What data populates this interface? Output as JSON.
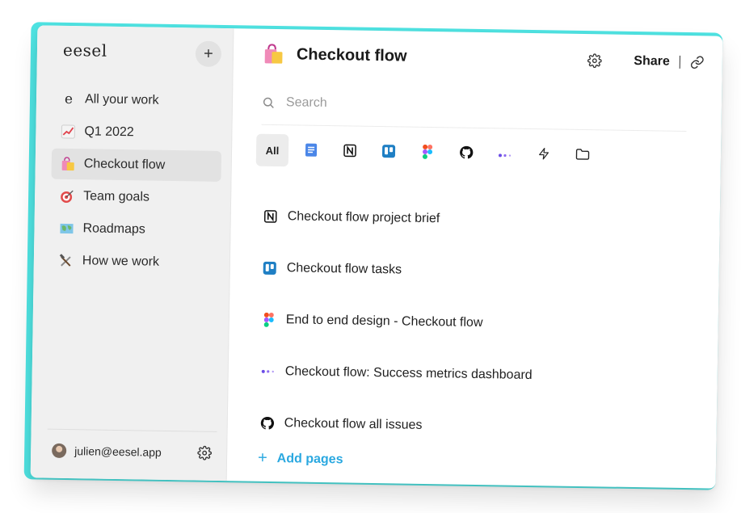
{
  "app": {
    "logo": "eesel"
  },
  "sidebar": {
    "add_symbol": "+",
    "items": [
      {
        "label": "All your work",
        "icon": "eesel-e-icon",
        "glyph": "e"
      },
      {
        "label": "Q1 2022",
        "icon": "chart-increasing-emoji",
        "glyph": "📈"
      },
      {
        "label": "Checkout flow",
        "icon": "shopping-bags-emoji",
        "glyph": "🛍️"
      },
      {
        "label": "Team goals",
        "icon": "direct-hit-emoji",
        "glyph": "🎯"
      },
      {
        "label": "Roadmaps",
        "icon": "world-map-emoji",
        "glyph": "🗺️"
      },
      {
        "label": "How we work",
        "icon": "hammer-wrench-emoji",
        "glyph": "🛠️"
      }
    ],
    "active_index": 2,
    "user": {
      "email": "julien@eesel.app"
    }
  },
  "main": {
    "title": "Checkout flow",
    "share_label": "Share",
    "search": {
      "placeholder": "Search"
    },
    "filters": [
      {
        "label": "All",
        "icon": "all-filter"
      },
      {
        "label": "",
        "icon": "google-docs-icon"
      },
      {
        "label": "",
        "icon": "notion-icon"
      },
      {
        "label": "",
        "icon": "trello-icon"
      },
      {
        "label": "",
        "icon": "figma-icon"
      },
      {
        "label": "",
        "icon": "github-icon"
      },
      {
        "label": "",
        "icon": "dots-icon"
      },
      {
        "label": "",
        "icon": "lightning-icon"
      },
      {
        "label": "",
        "icon": "folder-icon"
      }
    ],
    "results": [
      {
        "title": "Checkout flow project brief",
        "icon": "notion-icon"
      },
      {
        "title": "Checkout flow tasks",
        "icon": "trello-icon"
      },
      {
        "title": "End to end design - Checkout flow",
        "icon": "figma-icon"
      },
      {
        "title": "Checkout flow: Success metrics dashboard",
        "icon": "dots-icon"
      },
      {
        "title": "Checkout flow all issues",
        "icon": "github-icon"
      }
    ],
    "add_pages_label": "Add pages"
  },
  "colors": {
    "accent": "#2aa8e0",
    "teal_edge": "#4fe3e2",
    "sidebar_bg": "#f0f0f0"
  }
}
